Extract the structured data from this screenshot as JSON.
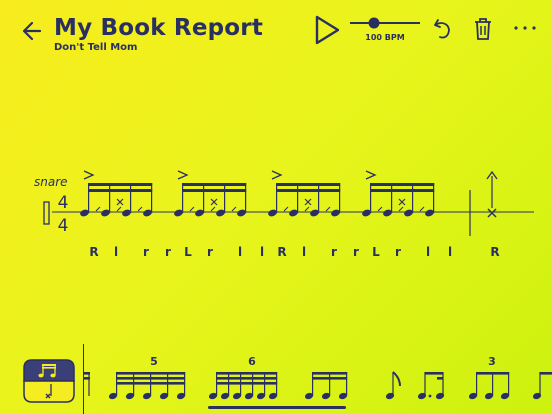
{
  "header": {
    "title": "My Book Report",
    "subtitle": "Don't Tell Mom",
    "tempo_label": "100 BPM"
  },
  "score": {
    "instrument": "snare",
    "time_signature": {
      "top": "4",
      "bottom": "4"
    },
    "sticking": [
      "R",
      "l",
      "r",
      "r",
      "L",
      "r",
      "l",
      "l",
      "R",
      "l",
      "r",
      "r",
      "L",
      "r",
      "l",
      "l",
      "R"
    ]
  },
  "palette": {
    "tuplet_labels": [
      "5",
      "6",
      "3"
    ],
    "selected_item": "sextuplet"
  },
  "colors": {
    "ink": "#2a2f62",
    "background": "#e9f41c",
    "toggle_bg": "#3b3f78",
    "toggle_fg": "#f6ec22"
  }
}
